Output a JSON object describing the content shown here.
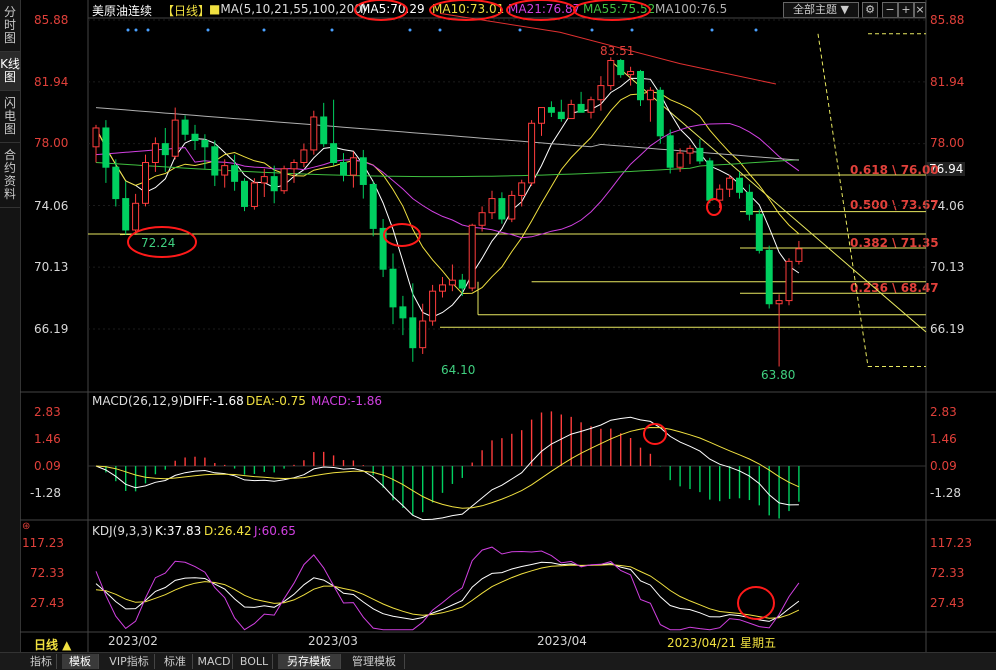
{
  "sidebar": {
    "tabs": [
      "分时图",
      "K线图",
      "闪电图",
      "合约资料"
    ]
  },
  "header": {
    "title": "美原油连续",
    "period": "【日线】",
    "ma_label": "MA(5,10,21,55,100,200)",
    "ma5": "MA5:70.29",
    "ma10": "MA10:73.01",
    "ma21": "MA21:76.87",
    "ma55": "MA55:75.52",
    "ma100": "MA100:76.5",
    "theme_button": "全部主题 ▼",
    "colors": {
      "ma5": "#ffffff",
      "ma10": "#f0e040",
      "ma21": "#d040e0",
      "ma55": "#40c040",
      "ma100": "#b0b0b0"
    }
  },
  "price_axis": {
    "left": [
      "85.88",
      "81.94",
      "78.00",
      "74.06",
      "70.13",
      "66.19"
    ],
    "right": [
      "85.88",
      "81.94",
      "78.00",
      "74.06",
      "70.13",
      "66.19"
    ]
  },
  "price_annotations": {
    "high": "83.51",
    "low_feb": "72.24",
    "low_mar": "64.10",
    "low_apr": "63.80"
  },
  "fib_levels": [
    "0.618 \\ 76.00",
    "0.500 \\ 73.67",
    "0.382 \\ 71.35",
    "0.236 \\ 68.47"
  ],
  "last_price": "76.94",
  "macd": {
    "title": "MACD(26,12,9)",
    "diff": "DIFF:-1.68",
    "dea": "DEA:-0.75",
    "macd": "MACD:-1.86",
    "axis": [
      "2.83",
      "1.46",
      "0.09",
      "-1.28"
    ]
  },
  "kdj": {
    "title": "KDJ(9,3,3)",
    "k": "K:37.83",
    "d": "D:26.42",
    "j": "J:60.65",
    "axis": [
      "117.23",
      "72.33",
      "27.43"
    ]
  },
  "date_axis": {
    "period_label": "日线 ▲",
    "dates": [
      "2023/02",
      "2023/03",
      "2023/04"
    ],
    "cursor_date": "2023/04/21 星期五"
  },
  "bottom_tabs": [
    "指标",
    "模板",
    "VIP指标",
    "标准",
    "MACD",
    "BOLL",
    "另存模板",
    "管理模板"
  ],
  "chart_data": {
    "type": "candlestick",
    "ohlc": [
      [
        77.8,
        79.2,
        76.8,
        79.0
      ],
      [
        79.0,
        79.5,
        75.5,
        76.5
      ],
      [
        76.5,
        77.0,
        74.0,
        74.5
      ],
      [
        74.5,
        75.6,
        72.2,
        72.5
      ],
      [
        72.5,
        74.8,
        72.3,
        74.2
      ],
      [
        74.2,
        77.3,
        74.0,
        76.8
      ],
      [
        76.8,
        78.4,
        76.2,
        78.0
      ],
      [
        78.0,
        79.0,
        76.2,
        77.3
      ],
      [
        77.2,
        80.3,
        77.0,
        79.5
      ],
      [
        79.5,
        79.8,
        78.2,
        78.6
      ],
      [
        78.6,
        79.2,
        77.6,
        78.2
      ],
      [
        78.2,
        78.6,
        76.4,
        77.8
      ],
      [
        77.8,
        78.2,
        75.3,
        76.0
      ],
      [
        76.0,
        77.0,
        75.2,
        76.6
      ],
      [
        76.6,
        77.3,
        75.0,
        75.6
      ],
      [
        75.6,
        75.8,
        73.7,
        74.0
      ],
      [
        74.0,
        75.8,
        73.8,
        75.5
      ],
      [
        75.5,
        76.4,
        74.6,
        75.9
      ],
      [
        75.9,
        76.6,
        74.2,
        75.0
      ],
      [
        75.0,
        76.6,
        74.8,
        76.4
      ],
      [
        76.4,
        77.0,
        75.5,
        76.8
      ],
      [
        76.8,
        78.0,
        76.5,
        77.6
      ],
      [
        77.6,
        80.1,
        77.3,
        79.7
      ],
      [
        79.7,
        80.6,
        77.8,
        78.0
      ],
      [
        78.0,
        80.8,
        76.6,
        76.8
      ],
      [
        76.8,
        77.4,
        75.6,
        76.0
      ],
      [
        76.0,
        77.5,
        75.2,
        77.1
      ],
      [
        77.1,
        77.6,
        74.5,
        75.4
      ],
      [
        75.4,
        75.6,
        72.1,
        72.6
      ],
      [
        72.6,
        73.2,
        69.5,
        70.0
      ],
      [
        70.0,
        71.0,
        66.5,
        67.6
      ],
      [
        67.6,
        68.3,
        65.8,
        66.9
      ],
      [
        66.9,
        69.1,
        64.1,
        65.0
      ],
      [
        65.0,
        67.8,
        64.6,
        66.7
      ],
      [
        66.7,
        69.0,
        66.4,
        68.6
      ],
      [
        68.6,
        69.5,
        68.2,
        69.0
      ],
      [
        69.0,
        70.3,
        68.6,
        69.3
      ],
      [
        69.3,
        69.7,
        68.3,
        68.8
      ],
      [
        68.8,
        72.9,
        68.6,
        72.8
      ],
      [
        72.8,
        74.0,
        72.4,
        73.6
      ],
      [
        73.6,
        75.0,
        73.2,
        74.5
      ],
      [
        74.5,
        74.9,
        72.9,
        73.2
      ],
      [
        73.2,
        75.0,
        73.0,
        74.7
      ],
      [
        74.7,
        75.7,
        74.0,
        75.5
      ],
      [
        75.5,
        79.5,
        75.3,
        79.3
      ],
      [
        79.3,
        80.0,
        78.5,
        80.3
      ],
      [
        80.3,
        80.7,
        79.7,
        80.0
      ],
      [
        80.0,
        80.8,
        79.4,
        79.6
      ],
      [
        79.6,
        80.8,
        79.6,
        80.5
      ],
      [
        80.5,
        81.3,
        80.0,
        80.0
      ],
      [
        80.0,
        81.0,
        79.6,
        80.8
      ],
      [
        80.8,
        82.3,
        80.1,
        81.7
      ],
      [
        81.7,
        83.5,
        81.4,
        83.3
      ],
      [
        83.3,
        83.4,
        82.2,
        82.4
      ],
      [
        82.4,
        82.9,
        81.7,
        82.6
      ],
      [
        82.6,
        82.7,
        80.4,
        80.8
      ],
      [
        80.8,
        81.6,
        79.4,
        81.4
      ],
      [
        81.4,
        81.6,
        78.0,
        78.5
      ],
      [
        78.5,
        78.9,
        76.1,
        76.5
      ],
      [
        76.5,
        77.7,
        76.2,
        77.4
      ],
      [
        77.4,
        77.9,
        76.7,
        77.7
      ],
      [
        77.7,
        78.3,
        76.7,
        76.9
      ],
      [
        76.9,
        77.1,
        74.2,
        74.4
      ],
      [
        74.4,
        75.4,
        73.9,
        75.1
      ],
      [
        75.1,
        76.0,
        74.6,
        75.8
      ],
      [
        75.8,
        76.2,
        74.5,
        74.9
      ],
      [
        74.9,
        75.4,
        73.1,
        73.5
      ],
      [
        73.5,
        73.8,
        71.0,
        71.2
      ],
      [
        71.2,
        71.5,
        67.5,
        67.8
      ],
      [
        67.8,
        68.4,
        63.8,
        68.0
      ],
      [
        68.0,
        70.7,
        67.7,
        70.5
      ],
      [
        70.5,
        71.8,
        70.3,
        71.3
      ]
    ],
    "ylim": [
      63.0,
      87.0
    ],
    "fib_retracement": {
      "high": 83.51,
      "low": 63.8,
      "levels": [
        {
          "ratio": 0.618,
          "price": 76.0
        },
        {
          "ratio": 0.5,
          "price": 73.67
        },
        {
          "ratio": 0.382,
          "price": 71.35
        },
        {
          "ratio": 0.236,
          "price": 68.47
        }
      ]
    },
    "horizontal_lines": [
      72.24,
      69.2,
      67.1,
      66.3
    ],
    "macd_ylim": [
      -2.9,
      3.3
    ],
    "kdj_ylim": [
      0,
      130
    ]
  }
}
